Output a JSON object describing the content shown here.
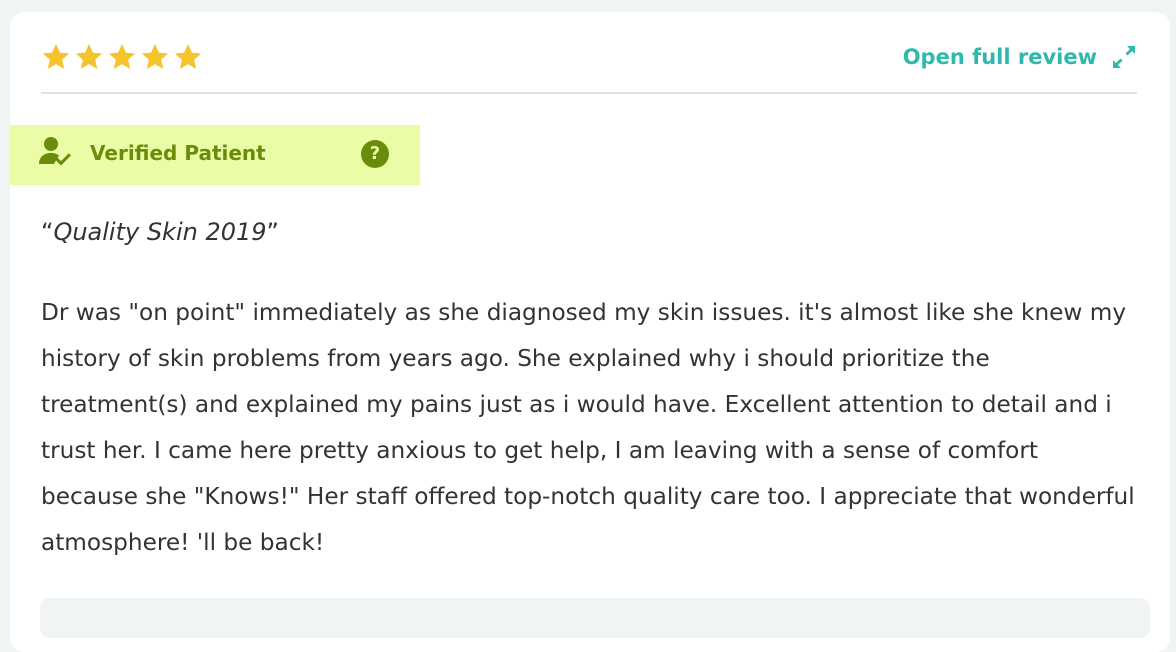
{
  "review": {
    "rating": {
      "value": 5,
      "max": 5,
      "star_color": "#f5c32c"
    },
    "open_full_review_label": "Open full review",
    "verified_label": "Verified Patient",
    "help_symbol": "?",
    "title": "Quality Skin 2019",
    "open_quote": "“",
    "close_quote": "”",
    "body": "Dr was \"on point\" immediately as she diagnosed my skin issues. it's almost like she knew my history of skin problems from years ago. She explained why i should prioritize the treatment(s) and explained my pains just as i would have. Excellent attention to detail and i trust her. I came here pretty anxious to get help, I am leaving with a sense of comfort because she \"Knows!\" Her staff offered top-notch quality care too. I appreciate that wonderful atmosphere! 'll be back!"
  },
  "icons": {
    "star": "star-icon",
    "expand": "expand-icon",
    "verified_user": "user-check-icon",
    "help": "question-icon"
  },
  "colors": {
    "accent_teal": "#2fb8ac",
    "verified_bg": "#eafca5",
    "verified_text": "#6a8c0b",
    "text": "#333333"
  }
}
